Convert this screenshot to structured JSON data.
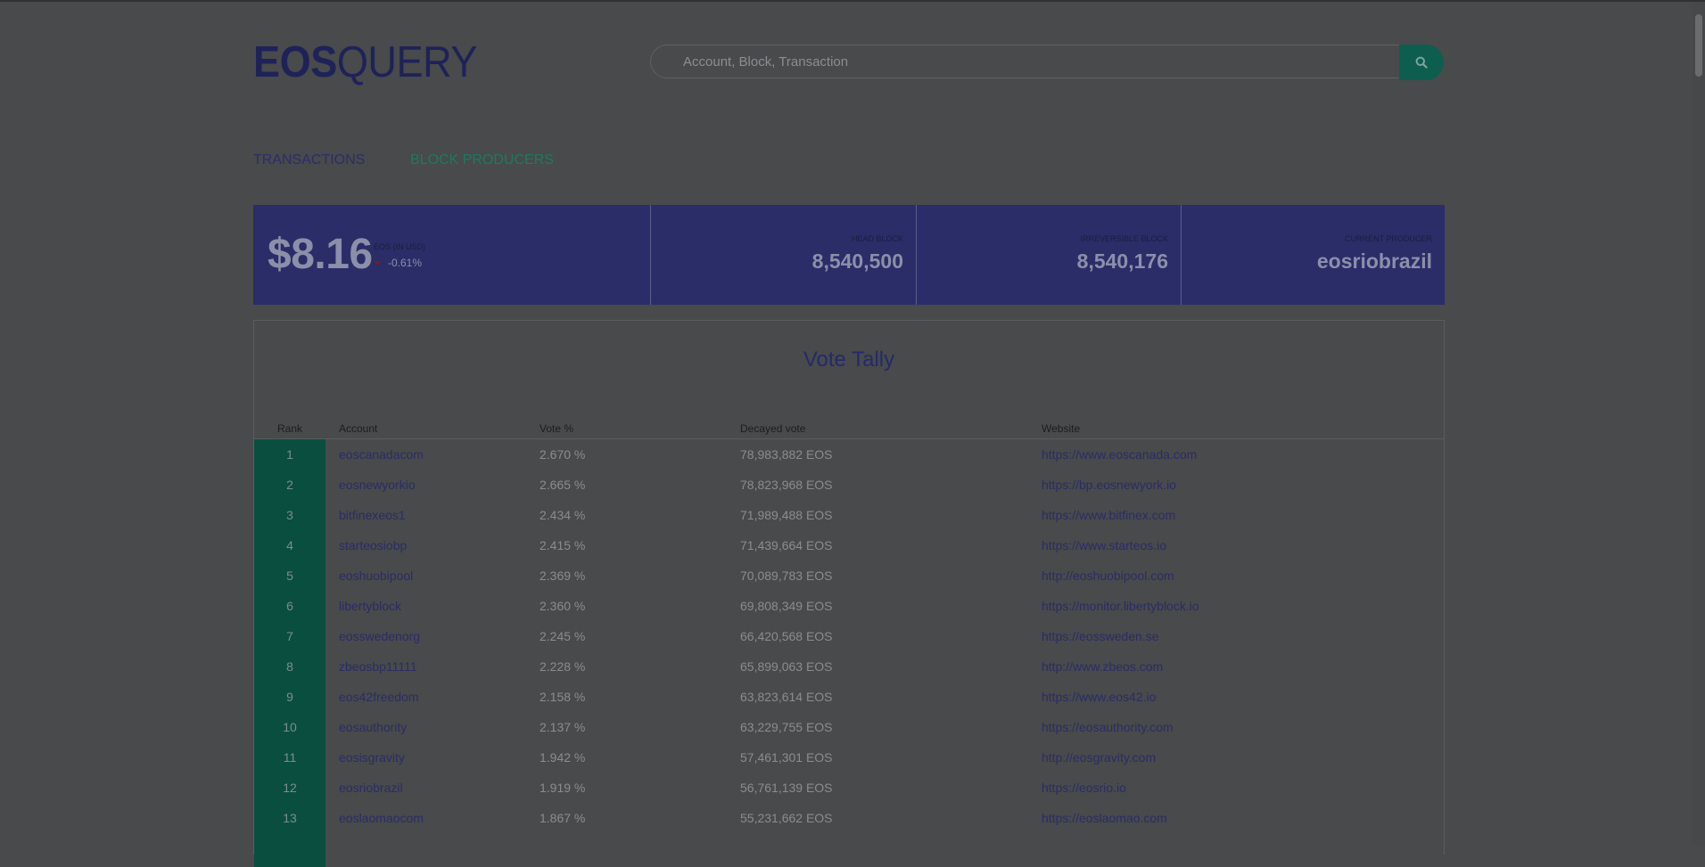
{
  "logo": {
    "bold": "EOS",
    "light": "QUERY"
  },
  "search": {
    "placeholder": "Account, Block, Transaction",
    "icon": "search-icon"
  },
  "nav": {
    "transactions": "TRANSACTIONS",
    "block_producers": "BLOCK PRODUCERS"
  },
  "stats": {
    "price": "$8.16",
    "price_label": "EOS (IN USD)",
    "price_change": "-0.61%",
    "head_block_label": "HEAD BLOCK",
    "head_block": "8,540,500",
    "irreversible_label": "IRREVERSIBLE BLOCK",
    "irreversible": "8,540,176",
    "producer_label": "CURRENT PRODUCER",
    "producer": "eosriobrazil"
  },
  "colors": {
    "accent_blue": "#2a2d68",
    "accent_green": "#0d5e4f",
    "negative": "#7a1b22"
  },
  "table": {
    "title": "Vote Tally",
    "headers": {
      "rank": "Rank",
      "account": "Account",
      "vote": "Vote %",
      "decayed": "Decayed vote",
      "website": "Website"
    },
    "rows": [
      {
        "rank": "1",
        "account": "eoscanadacom",
        "vote": "2.670 %",
        "decayed": "78,983,882 EOS",
        "website": "https://www.eoscanada.com"
      },
      {
        "rank": "2",
        "account": "eosnewyorkio",
        "vote": "2.665 %",
        "decayed": "78,823,968 EOS",
        "website": "https://bp.eosnewyork.io"
      },
      {
        "rank": "3",
        "account": "bitfinexeos1",
        "vote": "2.434 %",
        "decayed": "71,989,488 EOS",
        "website": "https://www.bitfinex.com"
      },
      {
        "rank": "4",
        "account": "starteosiobp",
        "vote": "2.415 %",
        "decayed": "71,439,664 EOS",
        "website": "https://www.starteos.io"
      },
      {
        "rank": "5",
        "account": "eoshuobipool",
        "vote": "2.369 %",
        "decayed": "70,089,783 EOS",
        "website": "http://eoshuobipool.com"
      },
      {
        "rank": "6",
        "account": "libertyblock",
        "vote": "2.360 %",
        "decayed": "69,808,349 EOS",
        "website": "https://monitor.libertyblock.io"
      },
      {
        "rank": "7",
        "account": "eosswedenorg",
        "vote": "2.245 %",
        "decayed": "66,420,568 EOS",
        "website": "https://eossweden.se"
      },
      {
        "rank": "8",
        "account": "zbeosbp11111",
        "vote": "2.228 %",
        "decayed": "65,899,063 EOS",
        "website": "http://www.zbeos.com"
      },
      {
        "rank": "9",
        "account": "eos42freedom",
        "vote": "2.158 %",
        "decayed": "63,823,614 EOS",
        "website": "https://www.eos42.io"
      },
      {
        "rank": "10",
        "account": "eosauthority",
        "vote": "2.137 %",
        "decayed": "63,229,755 EOS",
        "website": "https://eosauthority.com"
      },
      {
        "rank": "11",
        "account": "eosisgravity",
        "vote": "1.942 %",
        "decayed": "57,461,301 EOS",
        "website": "http://eosgravity.com"
      },
      {
        "rank": "12",
        "account": "eosriobrazil",
        "vote": "1.919 %",
        "decayed": "56,761,139 EOS",
        "website": "https://eosrio.io"
      },
      {
        "rank": "13",
        "account": "eoslaomaocom",
        "vote": "1.867 %",
        "decayed": "55,231,662 EOS",
        "website": "https://eoslaomao.com"
      }
    ]
  }
}
